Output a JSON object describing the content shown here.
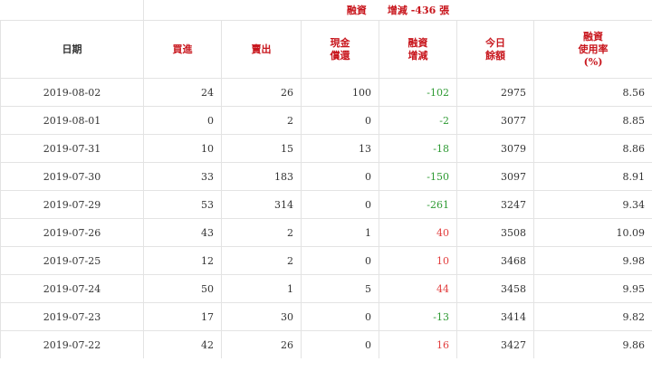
{
  "summary": {
    "label": "融資",
    "change_label": "增減",
    "change_value": "-436",
    "unit": "張"
  },
  "columns": [
    [
      "日期"
    ],
    [
      "買進"
    ],
    [
      "賣出"
    ],
    [
      "現金",
      "償還"
    ],
    [
      "融資",
      "增減"
    ],
    [
      "今日",
      "餘額"
    ],
    [
      "融資",
      "使用率",
      "(%)"
    ]
  ],
  "rows": [
    [
      "2019-08-02",
      "24",
      "26",
      "100",
      "-102",
      "2975",
      "8.56"
    ],
    [
      "2019-08-01",
      "0",
      "2",
      "0",
      "-2",
      "3077",
      "8.85"
    ],
    [
      "2019-07-31",
      "10",
      "15",
      "13",
      "-18",
      "3079",
      "8.86"
    ],
    [
      "2019-07-30",
      "33",
      "183",
      "0",
      "-150",
      "3097",
      "8.91"
    ],
    [
      "2019-07-29",
      "53",
      "314",
      "0",
      "-261",
      "3247",
      "9.34"
    ],
    [
      "2019-07-26",
      "43",
      "2",
      "1",
      "40",
      "3508",
      "10.09"
    ],
    [
      "2019-07-25",
      "12",
      "2",
      "0",
      "10",
      "3468",
      "9.98"
    ],
    [
      "2019-07-24",
      "50",
      "1",
      "5",
      "44",
      "3458",
      "9.95"
    ],
    [
      "2019-07-23",
      "17",
      "30",
      "0",
      "-13",
      "3414",
      "9.82"
    ],
    [
      "2019-07-22",
      "42",
      "26",
      "0",
      "16",
      "3427",
      "9.86"
    ]
  ],
  "colors": {
    "header_red": "#c8161d",
    "negative_green": "#2e9a33",
    "positive_red": "#e23d3d"
  }
}
